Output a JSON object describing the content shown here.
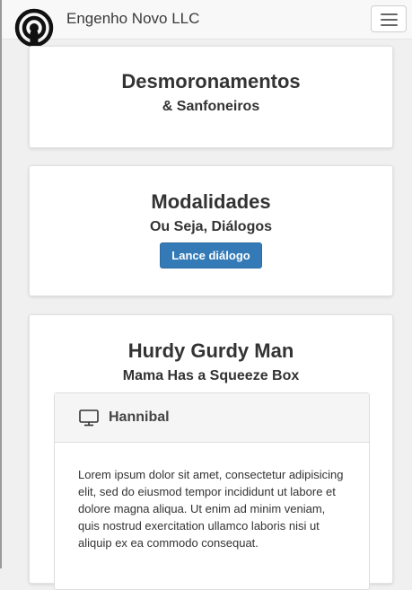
{
  "navbar": {
    "brand_name": "Engenho Novo LLC",
    "logo_icon": "podcast-icon",
    "toggle_icon": "hamburger-menu-icon"
  },
  "cards": [
    {
      "title": "Desmoronamentos",
      "subtitle": "& Sanfoneiros"
    },
    {
      "title": "Modalidades",
      "subtitle": "Ou Seja, Diálogos",
      "button_label": "Lance diálogo"
    },
    {
      "title": "Hurdy Gurdy Man",
      "subtitle": "Mama Has a Squeeze Box",
      "panel": {
        "icon": "monitor-icon",
        "title": "Hannibal",
        "body": "Lorem ipsum dolor sit amet, consectetur adipisicing elit, sed do eiusmod tempor incididunt ut labore et dolore magna aliqua. Ut enim ad minim veniam, quis nostrud exercitation ullamco laboris nisi ut aliquip ex ea commodo consequat."
      }
    }
  ],
  "colors": {
    "primary": "#337ab7",
    "navbar_bg": "#f8f8f8",
    "page_bg": "#f0f0f0"
  }
}
